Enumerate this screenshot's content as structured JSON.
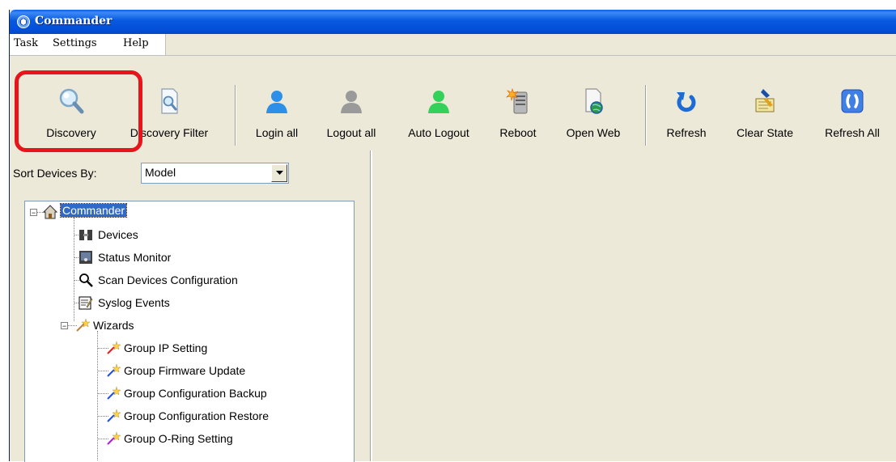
{
  "window": {
    "title": "Commander",
    "app_icon": "commander-app-icon"
  },
  "menu": {
    "items": [
      "Task",
      "Settings",
      "Help"
    ]
  },
  "toolbar": {
    "buttons": [
      {
        "label": "Discovery",
        "icon": "magnifier-icon"
      },
      {
        "label": "Discovery Filter",
        "icon": "document-search-icon"
      },
      {
        "label": "Login all",
        "icon": "user-blue-icon"
      },
      {
        "label": "Logout all",
        "icon": "user-gray-icon"
      },
      {
        "label": "Auto Logout",
        "icon": "user-green-icon"
      },
      {
        "label": "Reboot",
        "icon": "server-reboot-icon"
      },
      {
        "label": "Open Web",
        "icon": "web-page-icon"
      },
      {
        "label": "Refresh",
        "icon": "refresh-arrow-icon"
      },
      {
        "label": "Clear State",
        "icon": "clear-brush-icon"
      },
      {
        "label": "Refresh All",
        "icon": "refresh-all-icon"
      }
    ],
    "highlighted": "Discovery"
  },
  "sort": {
    "label": "Sort Devices By:",
    "value": "Model"
  },
  "tree": {
    "root": "Commander",
    "children": [
      "Devices",
      "Status Monitor",
      "Scan Devices Configuration",
      "Syslog Events",
      "Wizards"
    ],
    "wizards": [
      "Group IP Setting",
      "Group Firmware Update",
      "Group Configuration Backup",
      "Group Configuration Restore",
      "Group O-Ring Setting"
    ]
  },
  "colors": {
    "title_bar": "#0450d8",
    "highlight": "#e8141c",
    "selection": "#316ac5",
    "panel": "#ece9d8"
  }
}
